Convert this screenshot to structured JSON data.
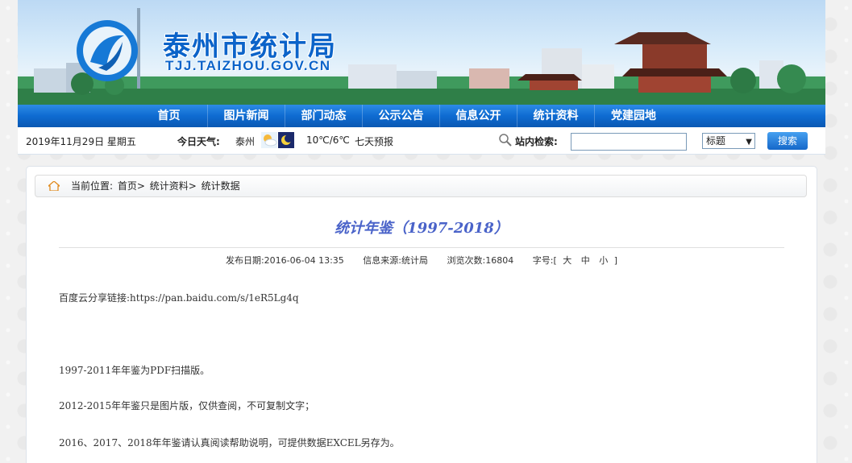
{
  "header": {
    "site_title": "泰州市统计局",
    "site_url": "TJJ.TAIZHOU.GOV.CN"
  },
  "nav": {
    "items": [
      "首页",
      "图片新闻",
      "部门动态",
      "公示公告",
      "信息公开",
      "统计资料",
      "党建园地"
    ]
  },
  "infobar": {
    "date": "2019年11月29日  星期五",
    "weather_label": "今日天气:",
    "weather_city": "泰州",
    "weather_temp": "10℃/6℃",
    "weather_forecast": "七天预报",
    "search_label": "站内检索:",
    "search_value": "",
    "search_select": "标题",
    "search_button": "搜索"
  },
  "breadcrumb": {
    "prefix": "当前位置:",
    "items": [
      "首页>",
      "统计资料>",
      "统计数据"
    ]
  },
  "article": {
    "title": "统计年鉴（1997-2018）",
    "publish_label": "发布日期:",
    "publish_date": "2016-06-04 13:35",
    "source_label": "信息来源:",
    "source": "统计局",
    "views_label": "浏览次数:",
    "views": "16804",
    "font_label": "字号:",
    "font_open": "[",
    "font_large": "大",
    "font_medium": "中",
    "font_small": "小",
    "font_close": "]",
    "share_label": "百度云分享链接:",
    "share_link": "https://pan.baidu.com/s/1eR5Lg4q",
    "p2": "1997-2011年年鉴为PDF扫描版。",
    "p3": "2012-2015年年鉴只是图片版，仅供查阅，不可复制文字；",
    "p4": "2016、2017、2018年年鉴请认真阅读帮助说明，可提供数据EXCEL另存为。"
  },
  "colors": {
    "nav_blue": "#0e6bd1",
    "title_blue": "#4a63c9",
    "brand_blue": "#0b63c9"
  }
}
